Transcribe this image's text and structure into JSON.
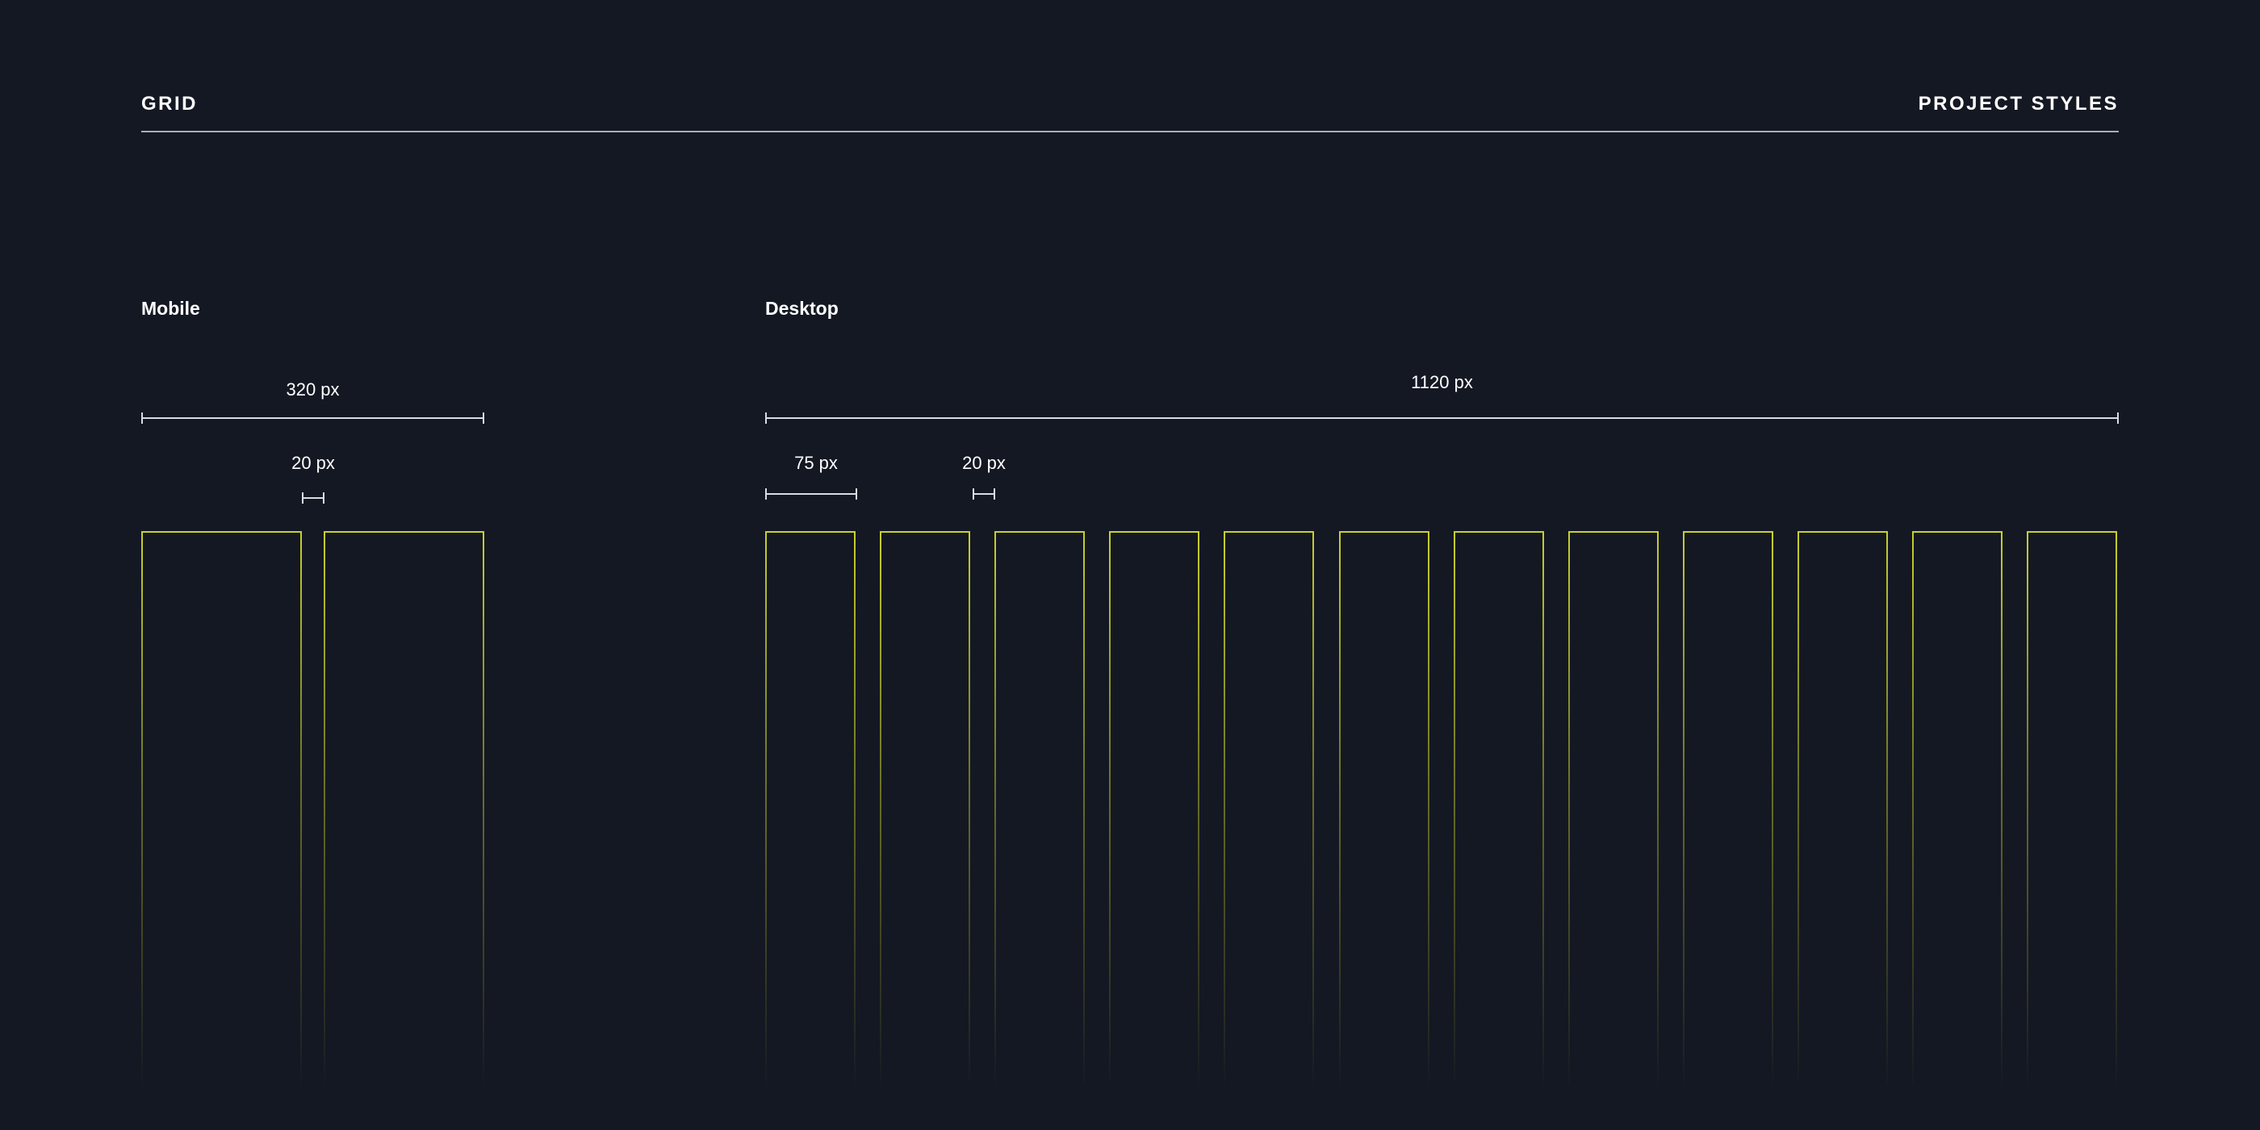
{
  "header": {
    "title": "GRID",
    "section": "PROJECT STYLES"
  },
  "mobile": {
    "title": "Mobile",
    "total_width_label": "320 px",
    "gutter_label": "20 px",
    "columns": 2
  },
  "desktop": {
    "title": "Desktop",
    "total_width_label": "1120 px",
    "column_width_label": "75 px",
    "gutter_label": "20 px",
    "columns": 12
  },
  "colors": {
    "background": "#141823",
    "column_stroke": "#c9d12b",
    "rule": "#a9adb6",
    "text": "#ffffff"
  }
}
